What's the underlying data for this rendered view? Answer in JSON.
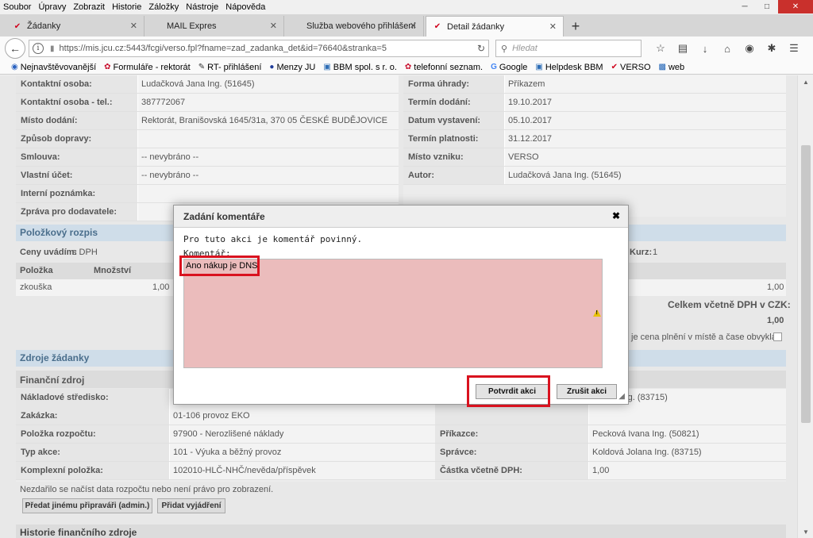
{
  "menubar": [
    "Soubor",
    "Úpravy",
    "Zobrazit",
    "Historie",
    "Záložky",
    "Nástroje",
    "Nápověda"
  ],
  "tabs": [
    {
      "label": "Žádanky",
      "active": false
    },
    {
      "label": "MAIL Expres",
      "active": false
    },
    {
      "label": "Služba webového přihlášení",
      "active": false
    },
    {
      "label": "Detail žádanky",
      "active": true
    }
  ],
  "nav": {
    "url": "https://mis.jcu.cz:5443/fcgi/verso.fpl?fname=zad_zadanka_det&id=76640&stranka=5",
    "search_placeholder": "Hledat"
  },
  "bookmarks": [
    {
      "label": "Nejnavštěvovanější",
      "icon": "globe-icon"
    },
    {
      "label": "Formuláře - rektorát",
      "icon": "flower-icon"
    },
    {
      "label": "RT- přihlášení",
      "icon": "pen-icon"
    },
    {
      "label": "Menzy JU",
      "icon": "cup-icon"
    },
    {
      "label": "BBM spol. s r. o.",
      "icon": "page-icon"
    },
    {
      "label": "telefonní seznam.",
      "icon": "flower-icon"
    },
    {
      "label": "Google",
      "icon": "google-icon"
    },
    {
      "label": "Helpdesk BBM",
      "icon": "page-icon"
    },
    {
      "label": "VERSO",
      "icon": "verso-icon"
    },
    {
      "label": "web",
      "icon": "web-icon"
    }
  ],
  "left_rows": [
    {
      "label": "Kontaktní osoba:",
      "value": "Ludačková Jana Ing. (51645)"
    },
    {
      "label": "Kontaktní osoba - tel.:",
      "value": "387772067"
    },
    {
      "label": "Místo dodání:",
      "value": "Rektorát, Branišovská 1645/31a, 370 05 ČESKÉ BUDĚJOVICE"
    },
    {
      "label": "Způsob dopravy:",
      "value": ""
    },
    {
      "label": "Smlouva:",
      "value": "-- nevybráno --"
    },
    {
      "label": "Vlastní účet:",
      "value": "-- nevybráno --"
    },
    {
      "label": "Interní poznámka:",
      "value": ""
    },
    {
      "label": "Zpráva pro dodavatele:",
      "value": ""
    }
  ],
  "right_rows": [
    {
      "label": "Forma úhrady:",
      "value": "Příkazem"
    },
    {
      "label": "Termín dodání:",
      "value": "19.10.2017"
    },
    {
      "label": "Datum vystavení:",
      "value": "05.10.2017"
    },
    {
      "label": "Termín platnosti:",
      "value": "31.12.2017"
    },
    {
      "label": "Místo vzniku:",
      "value": "VERSO"
    },
    {
      "label": "Autor:",
      "value": "Ludačková Jana Ing. (51645)"
    }
  ],
  "items_section": {
    "title": "Položkový rozpis",
    "prices_label": "Ceny uvádím:",
    "prices_value": "s DPH",
    "kurz_label": "Kurz:",
    "kurz_value": "1",
    "col_item": "Položka",
    "col_qty": "Množství",
    "row_item": "zkouška",
    "row_qty": "1,00",
    "row_right": "1,00",
    "total_label": "Celkem včetně DPH v CZK:",
    "total_value": "1,00",
    "note": "je cena plnění v místě a čase obvyklá:"
  },
  "sources": {
    "title": "Zdroje žádanky",
    "subtitle": "Finanční zdroj",
    "rows_left": [
      {
        "label": "Nákladové středisko:",
        "value": ""
      },
      {
        "label": "Zakázka:",
        "value": "01-106 provoz EKO"
      },
      {
        "label": "Položka rozpočtu:",
        "value": "97900 - Nerozlišené náklady"
      },
      {
        "label": "Typ akce:",
        "value": "101 - Výuka a běžný provoz"
      },
      {
        "label": "Komplexní položka:",
        "value": "102010-HLČ-NHČ/nevěda/příspěvek"
      }
    ],
    "rows_right": [
      {
        "label": "",
        "value": "Jolana Ing. (83715)"
      },
      {
        "label": "Příkazce:",
        "value": "Pecková Ivana Ing. (50821)"
      },
      {
        "label": "Správce:",
        "value": "Koldová Jolana Ing. (83715)"
      },
      {
        "label": "Částka včetně DPH:",
        "value": "1,00"
      }
    ],
    "error": "Nezdařilo se načíst data rozpočtu nebo není právo pro zobrazení.",
    "btn_forward": "Předat jinému připraváři (admin.)",
    "btn_add": "Přidat vyjádření",
    "history_title": "Historie finančního zdroje"
  },
  "dialog": {
    "title": "Zadání komentáře",
    "message": "Pro tuto akci je komentář povinný.",
    "comment_label": "Komentář:",
    "comment_value": "Ano nákup je DNS",
    "confirm": "Potvrdit akci",
    "cancel": "Zrušit akci"
  },
  "colors": {
    "section_head_bg": "#cfdde9",
    "section_head_text": "#4a6e8c",
    "textarea_error_bg": "#ebbcbc",
    "highlight": "#d9121f"
  }
}
